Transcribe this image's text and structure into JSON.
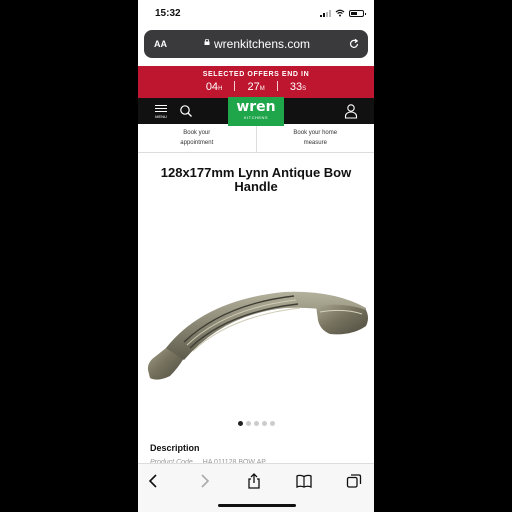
{
  "status_bar": {
    "time": "15:32"
  },
  "browser": {
    "text_size_label": "AA",
    "url": "wrenkitchens.com"
  },
  "offer_banner": {
    "headline": "SELECTED OFFERS END IN",
    "hours": "04",
    "hours_unit": "H",
    "minutes": "27",
    "minutes_unit": "M",
    "seconds": "33",
    "seconds_unit": "S"
  },
  "nav": {
    "menu_label": "MENU",
    "logo_text": "wren",
    "logo_sub": "KITCHENS"
  },
  "appointments": {
    "left_line1": "Book your",
    "left_line2": "appointment",
    "right_line1": "Book your home",
    "right_line2": "measure"
  },
  "product": {
    "title_line1": "128x177mm Lynn Antique Bow",
    "title_line2": "Handle",
    "gallery_count": 5,
    "gallery_active": 1
  },
  "description": {
    "heading": "Description",
    "product_code_label": "Product Code",
    "product_code_value": "HA 011128 BOW AP"
  },
  "colors": {
    "banner_red": "#bf1630",
    "logo_green": "#1fa64a",
    "nav_black": "#111111"
  }
}
